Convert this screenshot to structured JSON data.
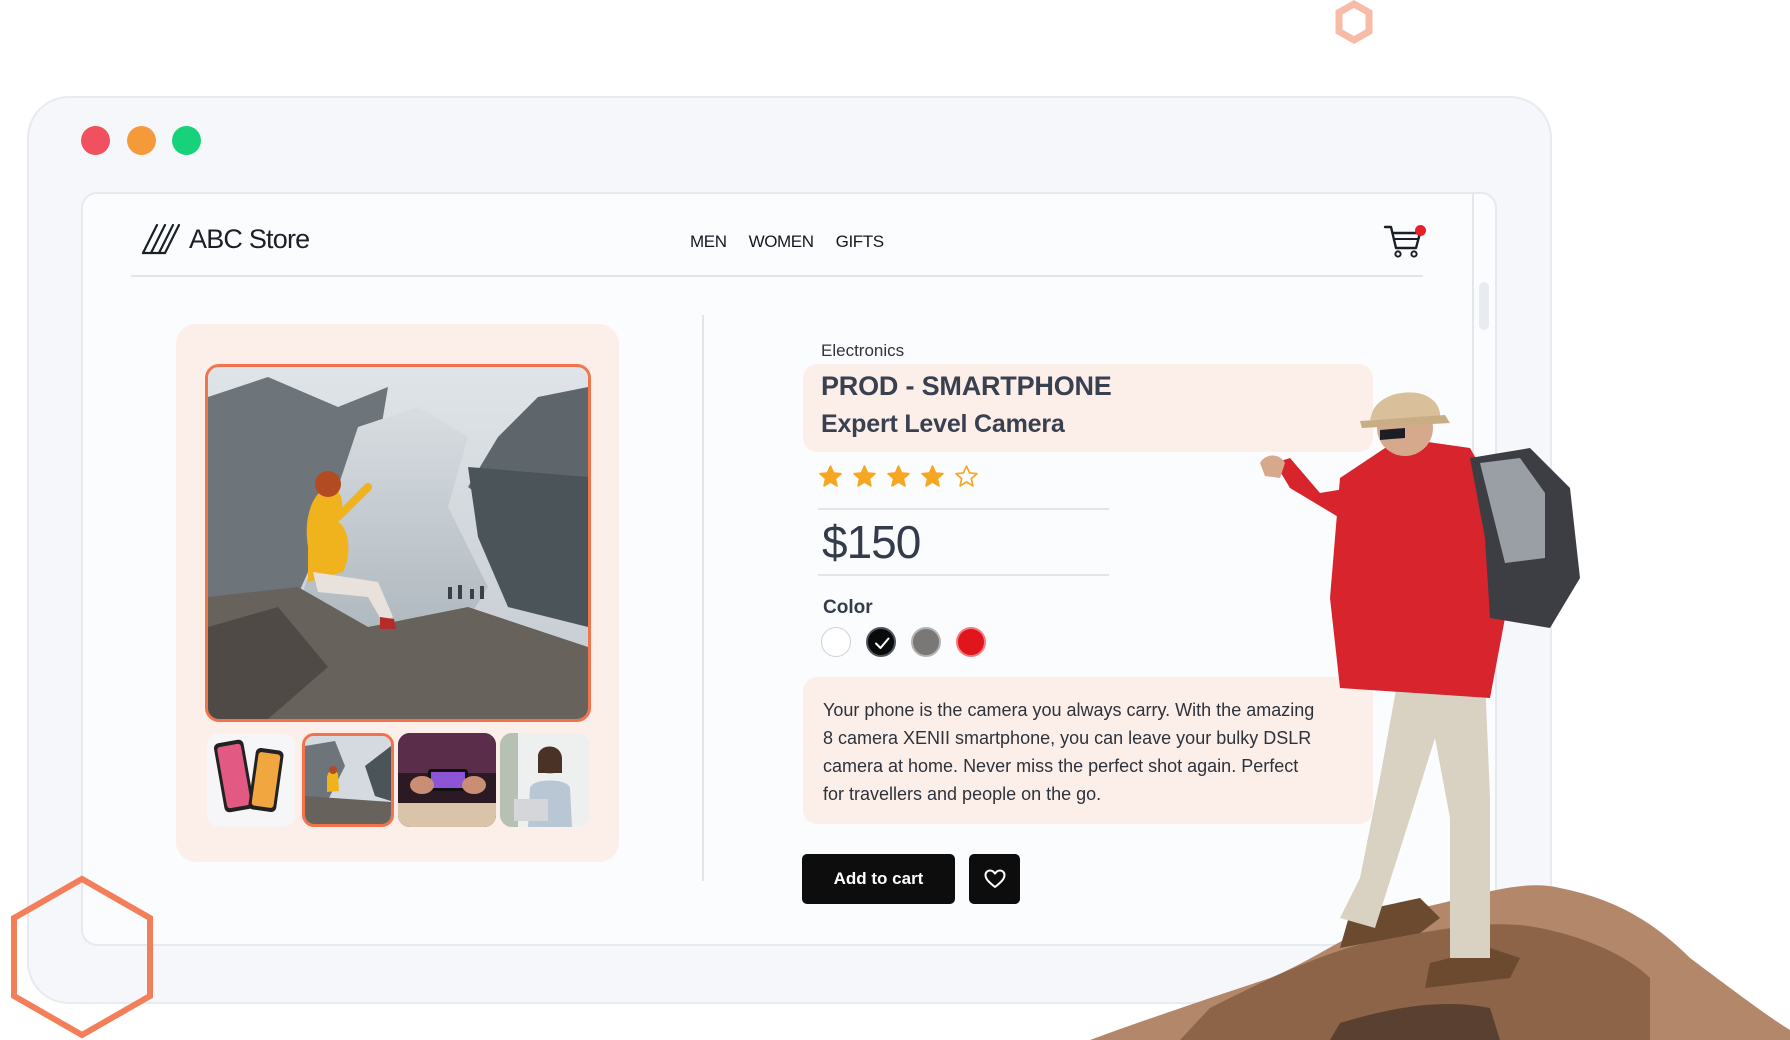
{
  "store": {
    "name": "ABC Store",
    "logo_icon": "diagonal-stripes-logo",
    "nav": [
      "MEN",
      "WOMEN",
      "GIFTS"
    ],
    "cart_icon": "shopping-cart-icon",
    "cart_has_items": true
  },
  "window": {
    "controls": [
      "close",
      "minimize",
      "maximize"
    ],
    "control_colors": [
      "#f1515e",
      "#f59a3b",
      "#17d27a"
    ]
  },
  "gallery": {
    "main_image": "woman-photographing-fjord",
    "thumbnails": [
      "two-smartphones",
      "woman-photographing-fjord",
      "gaming-on-phone",
      "woman-using-phone-at-laptop"
    ],
    "selected_thumbnail_index": 1
  },
  "product": {
    "category": "Electronics",
    "name_line1": "PROD - SMARTPHONE",
    "name_line2": "Expert Level Camera",
    "rating": 4,
    "rating_max": 5,
    "price": "$150",
    "color_label": "Color",
    "colors": [
      "#ffffff",
      "#0a0a0a",
      "#7a7777",
      "#e0161c"
    ],
    "selected_color_index": 1,
    "description": "Your phone is the camera you always carry. With the amazing 8 camera XENII smartphone, you can leave your bulky DSLR camera at home. Never miss the perfect shot again. Perfect for travellers and people on the go.",
    "add_to_cart_label": "Add to cart",
    "wishlist_icon": "heart-icon"
  },
  "accent_color": "#f1744d",
  "panel_color": "#fcefe9"
}
